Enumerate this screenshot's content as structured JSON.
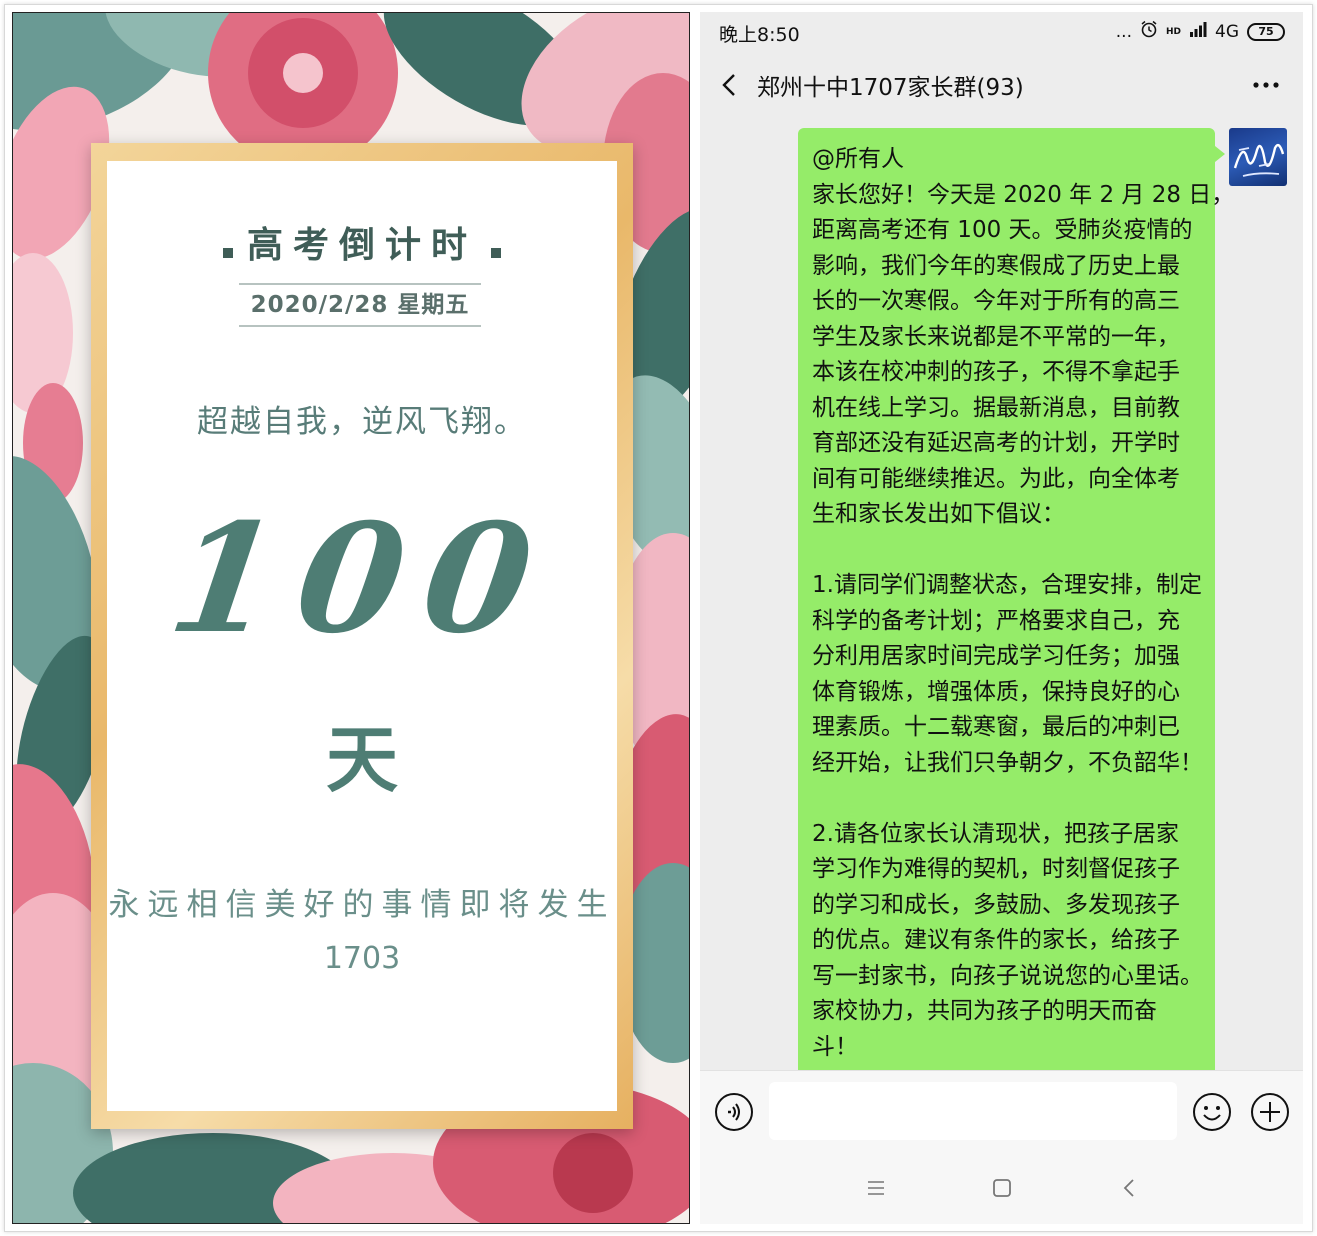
{
  "poster": {
    "title": "高考倒计时",
    "date": "2020/2/28  星期五",
    "slogan": "超越自我，逆风飞翔。",
    "countdown_number": "100",
    "countdown_unit": "天",
    "motto": "永远相信美好的事情即将发生",
    "class_code": "1703",
    "colors": {
      "teal": "#4e7d74",
      "gold": "#e9b86a",
      "pink": "#d85b72"
    }
  },
  "status_bar": {
    "time": "晚上8:50",
    "dots": "...",
    "alarm_icon": "alarm-clock-icon",
    "hd_label": "HD",
    "network": "4G",
    "battery": "75"
  },
  "nav": {
    "back_icon": "chevron-left-icon",
    "title": "郑州十中1707家长群(93)",
    "more_icon": "more-dots-icon"
  },
  "message": {
    "avatar_icon": "avatar-calligraphy",
    "lines": [
      "@所有人",
      "家长您好！今天是 2020 年 2 月 28 日，",
      "距离高考还有 100 天。受肺炎疫情的",
      "影响，我们今年的寒假成了历史上最",
      "长的一次寒假。今年对于所有的高三",
      "学生及家长来说都是不平常的一年，",
      "本该在校冲刺的孩子，不得不拿起手",
      "机在线上学习。据最新消息，目前教",
      "育部还没有延迟高考的计划，开学时",
      "间有可能继续推迟。为此，向全体考",
      "生和家长发出如下倡议：",
      "",
      "1.请同学们调整状态，合理安排，制定",
      "科学的备考计划；严格要求自己，充",
      "分利用居家时间完成学习任务；加强",
      "体育锻炼，增强体质，保持良好的心",
      "理素质。十二载寒窗，最后的冲刺已",
      "经开始，让我们只争朝夕，不负韶华！",
      "",
      "2.请各位家长认清现状，把孩子居家",
      "学习作为难得的契机，时刻督促孩子",
      "的学习和成长，多鼓励、多发现孩子",
      "的优点。建议有条件的家长，给孩子",
      "写一封家书，向孩子说说您的心里话。",
      "家校协力，共同为孩子的明天而奋",
      "斗！"
    ],
    "bubble_color": "#95ec69"
  },
  "input_bar": {
    "voice_icon": "voice-icon",
    "input_value": "",
    "emoji_icon": "emoji-icon",
    "plus_icon": "plus-icon"
  },
  "system_nav": {
    "menu_icon": "menu-icon",
    "home_icon": "home-square-icon",
    "back_icon": "back-triangle-icon"
  }
}
